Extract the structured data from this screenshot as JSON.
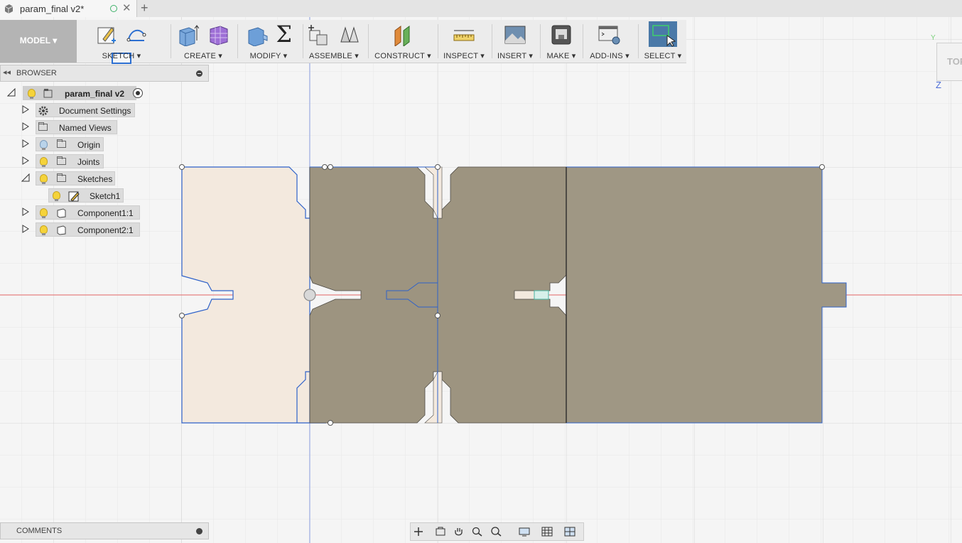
{
  "document": {
    "tab_title": "param_final v2*",
    "close_glyph": "✕",
    "new_tab_glyph": "+"
  },
  "toolbar": {
    "mode_label": "MODEL ▾",
    "groups": [
      {
        "label": "SKETCH ▾",
        "icons": [
          "create-sketch-icon",
          "line-arc-icon",
          "rectangle-icon"
        ]
      },
      {
        "label": "CREATE ▾",
        "icons": [
          "extrude-icon",
          "form-icon"
        ]
      },
      {
        "label": "MODIFY ▾",
        "icons": [
          "press-pull-icon",
          "parameters-sigma-icon"
        ]
      },
      {
        "label": "ASSEMBLE ▾",
        "icons": [
          "new-component-icon",
          "joint-icon"
        ]
      },
      {
        "label": "CONSTRUCT ▾",
        "icons": [
          "offset-plane-icon"
        ]
      },
      {
        "label": "INSPECT ▾",
        "icons": [
          "measure-icon"
        ]
      },
      {
        "label": "INSERT ▾",
        "icons": [
          "insert-image-icon"
        ]
      },
      {
        "label": "MAKE ▾",
        "icons": [
          "3d-print-icon"
        ]
      },
      {
        "label": "ADD-INS ▾",
        "icons": [
          "scripts-addins-icon"
        ]
      },
      {
        "label": "SELECT ▾",
        "icons": [
          "select-window-icon"
        ]
      }
    ],
    "sigma_glyph": "Σ"
  },
  "browser": {
    "title": "BROWSER",
    "collapse_glyph": "◂◂",
    "root": {
      "label": "param_final v2"
    },
    "items": [
      {
        "label": "Document Settings",
        "icon": "gear-icon",
        "bulb": "none"
      },
      {
        "label": "Named Views",
        "icon": "folder-icon",
        "bulb": "none"
      },
      {
        "label": "Origin",
        "icon": "folder-icon",
        "bulb": "off"
      },
      {
        "label": "Joints",
        "icon": "folder-icon",
        "bulb": "on"
      },
      {
        "label": "Sketches",
        "icon": "folder-icon",
        "bulb": "on",
        "expanded": true
      },
      {
        "label": "Sketch1",
        "icon": "sketch-icon",
        "bulb": "on",
        "child": true
      },
      {
        "label": "Component1:1",
        "icon": "component-icon",
        "bulb": "on"
      },
      {
        "label": "Component2:1",
        "icon": "component-icon",
        "bulb": "on"
      }
    ]
  },
  "comments": {
    "title": "COMMENTS"
  },
  "viewcube": {
    "face": "TOP",
    "axis_z": "Z",
    "axis_y": "Y"
  },
  "colors": {
    "part_fill": "#9d9480",
    "sketch_fill": "#f3e9de",
    "sketch_stroke": "#2f62c9",
    "grid": "#dcdcdc",
    "axis_red": "#e46565",
    "axis_blue": "#8ea2e4",
    "select_active": "#4a79a8"
  }
}
